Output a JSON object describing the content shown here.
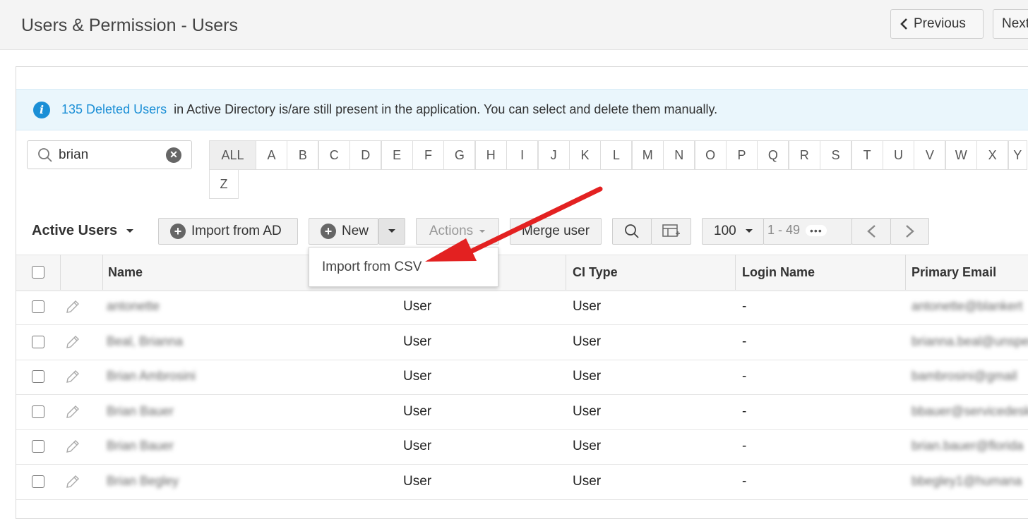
{
  "header": {
    "title": "Users & Permission - Users",
    "previous_label": "Previous",
    "next_label": "Next"
  },
  "info": {
    "link_text": "135 Deleted Users",
    "message": "in Active Directory is/are still present in the application. You can select and delete them manually."
  },
  "search": {
    "value": "brian"
  },
  "alphabet": [
    "ALL",
    "A",
    "B",
    "C",
    "D",
    "E",
    "F",
    "G",
    "H",
    "I",
    "J",
    "K",
    "L",
    "M",
    "N",
    "O",
    "P",
    "Q",
    "R",
    "S",
    "T",
    "U",
    "V",
    "W",
    "X",
    "Y",
    "Z"
  ],
  "toolbar": {
    "view_label": "Active Users",
    "import_ad_label": "Import from AD",
    "new_label": "New",
    "actions_label": "Actions",
    "merge_label": "Merge user",
    "page_size": "100",
    "range": "1 - 49",
    "more": "•••"
  },
  "new_menu": {
    "items": [
      "Import from CSV"
    ]
  },
  "table": {
    "columns": [
      "Name",
      "CI Type",
      "Login Name",
      "Primary Email"
    ],
    "rows": [
      {
        "name": "antonette",
        "type": "User",
        "ci_type": "User",
        "login": "-",
        "email": "antonette@blankert"
      },
      {
        "name": "Beal, Brianna",
        "type": "User",
        "ci_type": "User",
        "login": "-",
        "email": "brianna.beal@unspec"
      },
      {
        "name": "Brian Ambrosini",
        "type": "User",
        "ci_type": "User",
        "login": "-",
        "email": "bambrosini@gmail"
      },
      {
        "name": "Brian Bauer",
        "type": "User",
        "ci_type": "User",
        "login": "-",
        "email": "bbauer@servicedesk"
      },
      {
        "name": "Brian Bauer",
        "type": "User",
        "ci_type": "User",
        "login": "-",
        "email": "brian.bauer@florida"
      },
      {
        "name": "Brian Begley",
        "type": "User",
        "ci_type": "User",
        "login": "-",
        "email": "bbegley1@humana"
      }
    ]
  },
  "colors": {
    "accent": "#1b8fd6",
    "info_bg": "#eaf6fc",
    "arrow": "#e32121"
  }
}
